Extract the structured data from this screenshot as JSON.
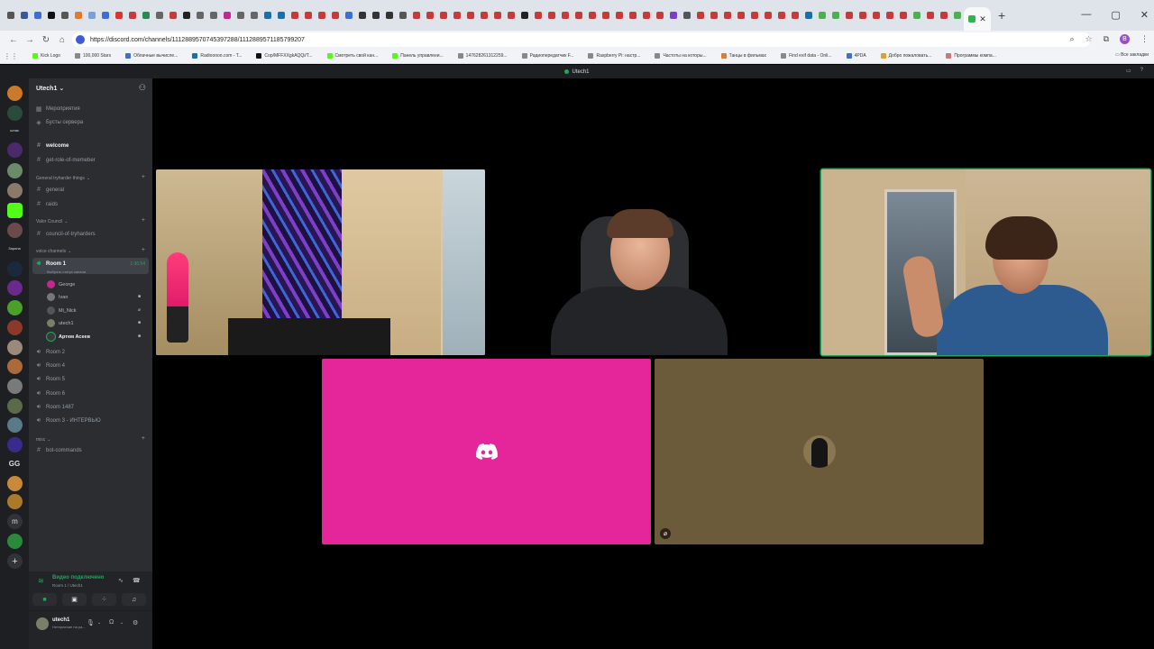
{
  "browser": {
    "url": "https://discord.com/channels/1112889570745397288/1112889571185799207",
    "bookmarks": [
      "Kick Logo",
      "100,000 Stars",
      "Облачные вычисле...",
      "Radiooooo.com - T...",
      "Сор/MFFXXgkAQQi/T...",
      "Смотреть свой кан...",
      "Панель управлени...",
      "147628261312259...",
      "Радиопередатчик F...",
      "Raspberry Pi: настр...",
      "Частоты на которы...",
      "Танцы в фильмах",
      "Find exif data - Onli...",
      "4PDA",
      "Добро пожаловать...",
      "Программы компа..."
    ],
    "all_bookmarks": "Все закладки"
  },
  "discord": {
    "window_title": "Utech1",
    "server_name": "Utech1",
    "nav": {
      "events": "Мероприятия",
      "boosts": "Бусты сервера"
    },
    "channels": {
      "welcome": "welcome",
      "get_role": "get-role-of-memeber",
      "cat_general": "General tryharder things",
      "general": "general",
      "raids": "raids",
      "cat_valor": "Valor Council",
      "council": "council-of-tryharders",
      "cat_voice": "voice channels",
      "room1": "Room 1",
      "room1_time": "1:36:54",
      "room1_status": "Выбрать статус канала",
      "room2": "Room 2",
      "room4": "Room 4",
      "room5": "Room 5",
      "room6": "Room 6",
      "room1487": "Room 1487",
      "room3": "Room 3 - ИНТЕРВЬЮ",
      "cat_misc": "misc",
      "bot_commands": "bot-commands"
    },
    "voice_users": [
      "George",
      "Ivan",
      "Mi_Nick",
      "utech1",
      "Артем Асеев"
    ],
    "voice_panel": {
      "connected": "Видео подключено",
      "room": "Room 1 / Utech1"
    },
    "user": {
      "name": "utech1",
      "status": "Нетерпение на ра..."
    }
  }
}
